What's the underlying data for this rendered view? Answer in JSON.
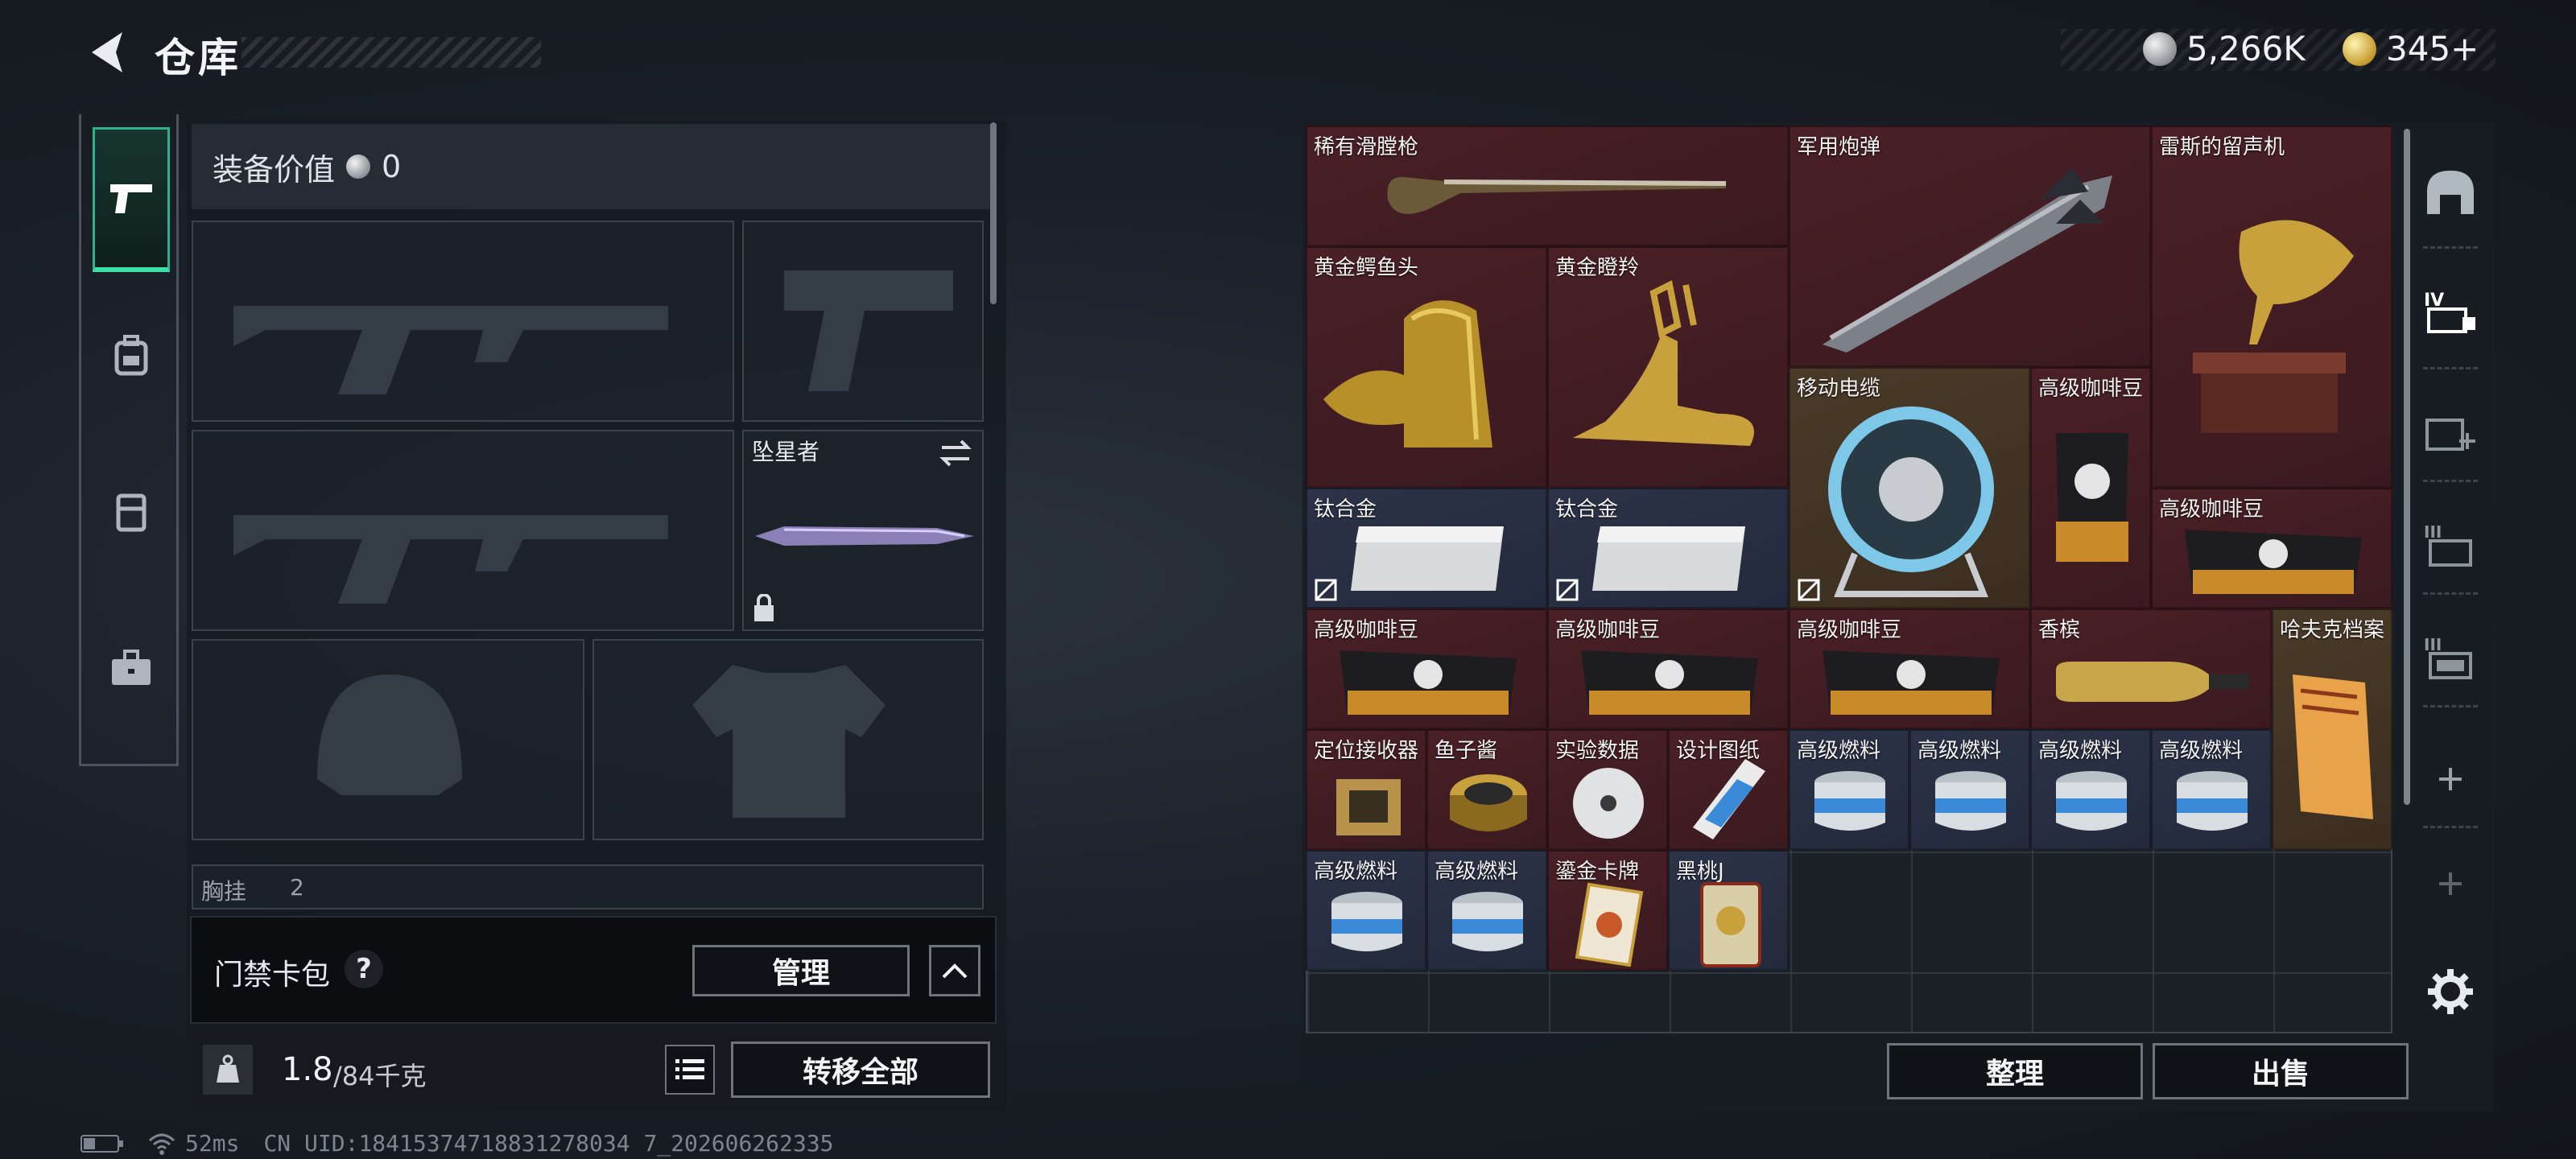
{
  "header": {
    "title": "仓库",
    "currency_silver": "5,266K",
    "currency_gold": "345+"
  },
  "loadout": {
    "equip_value_label": "装备价值",
    "equip_value": "0",
    "melee_slot_label": "坠星者",
    "chest_rig_label": "胸挂",
    "chest_rig_value": "2"
  },
  "keycard": {
    "label": "门禁卡包",
    "help": "?",
    "manage_button": "管理"
  },
  "weight": {
    "current": "1.8",
    "max": "/84千克",
    "transfer_all_button": "转移全部"
  },
  "status": {
    "ping": "52ms",
    "uid": "CN UID:18415374718831278034 7_202606262335"
  },
  "stash": {
    "items": [
      {
        "label": "稀有滑膛枪",
        "rarity": "red"
      },
      {
        "label": "军用炮弹",
        "rarity": "red"
      },
      {
        "label": "雷斯的留声机",
        "rarity": "red"
      },
      {
        "label": "黄金鳄鱼头",
        "rarity": "red"
      },
      {
        "label": "黄金瞪羚",
        "rarity": "red"
      },
      {
        "label": "移动电缆",
        "rarity": "gold"
      },
      {
        "label": "高级咖啡豆",
        "rarity": "red"
      },
      {
        "label": "钛合金",
        "rarity": "blue"
      },
      {
        "label": "钛合金",
        "rarity": "blue"
      },
      {
        "label": "高级咖啡豆",
        "rarity": "red"
      },
      {
        "label": "高级咖啡豆",
        "rarity": "red"
      },
      {
        "label": "高级咖啡豆",
        "rarity": "red"
      },
      {
        "label": "高级咖啡豆",
        "rarity": "red"
      },
      {
        "label": "香槟",
        "rarity": "red"
      },
      {
        "label": "哈夫克档案",
        "rarity": "gold"
      },
      {
        "label": "定位接收器",
        "rarity": "red"
      },
      {
        "label": "鱼子酱",
        "rarity": "red"
      },
      {
        "label": "实验数据",
        "rarity": "red"
      },
      {
        "label": "设计图纸",
        "rarity": "red"
      },
      {
        "label": "高级燃料",
        "rarity": "blue"
      },
      {
        "label": "高级燃料",
        "rarity": "blue"
      },
      {
        "label": "高级燃料",
        "rarity": "blue"
      },
      {
        "label": "高级燃料",
        "rarity": "blue"
      },
      {
        "label": "高级燃料",
        "rarity": "blue"
      },
      {
        "label": "高级燃料",
        "rarity": "blue"
      },
      {
        "label": "鎏金卡牌",
        "rarity": "red"
      },
      {
        "label": "黑桃J",
        "rarity": "blue"
      }
    ],
    "sort_button": "整理",
    "sell_button": "出售"
  },
  "colors": {
    "accent_green": "#3fe0a8",
    "rarity_red": "#4a2026",
    "rarity_blue": "#2c3348",
    "rarity_gold": "#4a3a28"
  }
}
